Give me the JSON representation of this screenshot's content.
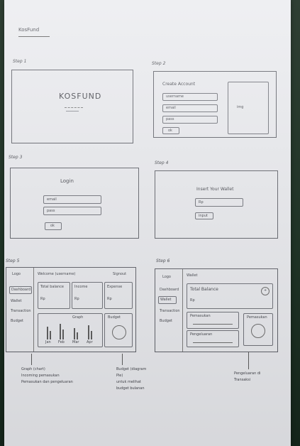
{
  "page": {
    "title": "KosFund"
  },
  "steps": [
    {
      "label": "Step 1"
    },
    {
      "label": "Step 2"
    },
    {
      "label": "Step 3"
    },
    {
      "label": "Step 4"
    },
    {
      "label": "Step 5"
    },
    {
      "label": "Step 6"
    }
  ],
  "step1": {
    "logo": "KOSFUND"
  },
  "step2": {
    "heading": "Create Account",
    "fields": [
      "username",
      "email",
      "pass"
    ],
    "button": "ok",
    "image_label": "img"
  },
  "step3": {
    "heading": "Login",
    "fields": [
      "email",
      "pass"
    ],
    "button": "ok"
  },
  "step4": {
    "heading": "Insert Your Wallet",
    "field": "Rp",
    "button": "input"
  },
  "step5": {
    "logo": "Logo",
    "welcome": "Welcome (username)",
    "account": "Signout",
    "nav": [
      "Dashboard",
      "Wallet",
      "Transaction",
      "Budget"
    ],
    "cards": [
      {
        "title": "Total balance",
        "value": "Rp"
      },
      {
        "title": "Income",
        "value": "Rp"
      },
      {
        "title": "Expense",
        "value": "Rp"
      }
    ],
    "graph_label": "Graph",
    "budget_label": "Budget",
    "months": [
      "Jan",
      "Feb",
      "Mar",
      "Apr"
    ],
    "notes_left": [
      "Graph (chart)",
      "Incoming pemasukan",
      "Pemasukan dan pengeluaran"
    ],
    "notes_right": [
      "Budget (diagram",
      "Pie)",
      "untuk melihat",
      "budget bulanan"
    ]
  },
  "step6": {
    "logo": "Logo",
    "heading": "Wallet",
    "nav": [
      "Dashboard",
      "Wallet",
      "Transaction",
      "Budget"
    ],
    "balance_title": "Total Balance",
    "balance_value": "Rp",
    "add_icon": "+",
    "rows": [
      "Pemasukan",
      "Pengeluaran"
    ],
    "pie_label": "Pemasukan",
    "notes": [
      "Pengeluaran di",
      "Transaksi"
    ]
  }
}
